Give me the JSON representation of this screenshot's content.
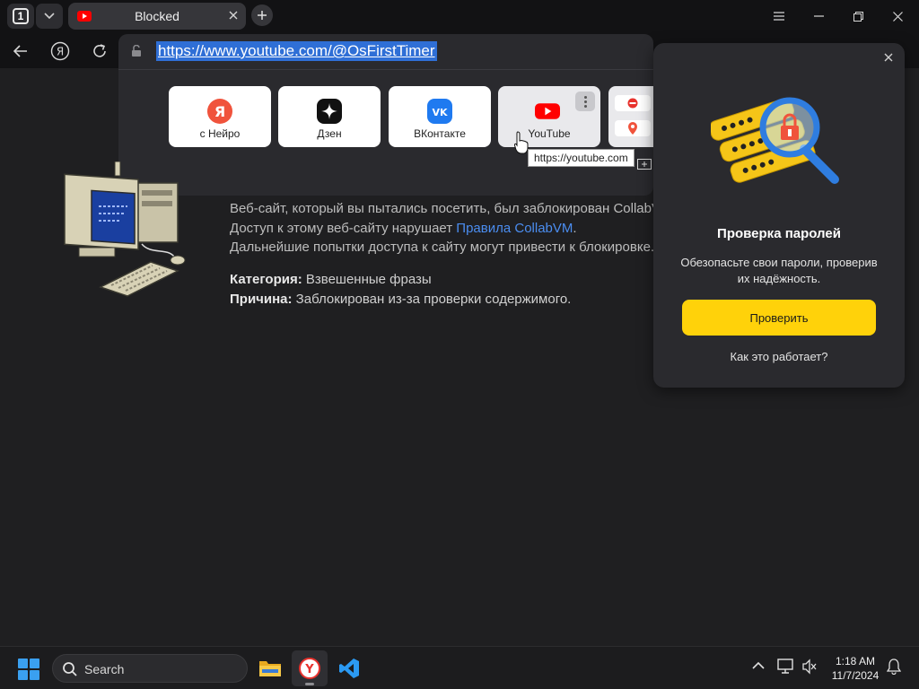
{
  "browser": {
    "tab_count": "1",
    "tab_title": "Blocked",
    "url": "https://www.youtube.com/@OsFirstTimer"
  },
  "speed_dial": {
    "tiles": [
      {
        "label": "с Нейро",
        "icon": "yandex-icon"
      },
      {
        "label": "Дзен",
        "icon": "dzen-icon"
      },
      {
        "label": "ВКонтакте",
        "icon": "vk-icon"
      },
      {
        "label": "YouTube",
        "icon": "youtube-icon"
      }
    ],
    "tooltip": "https://youtube.com"
  },
  "blocked_page": {
    "line1": "Веб-сайт, который вы пытались посетить, был заблокирован CollabVM.",
    "line2_prefix": "Доступ к этому веб-сайту нарушает ",
    "line2_link": "Правила CollabVM",
    "line2_suffix": ".",
    "line3": "Дальнейшие попытки доступа к сайту могут привести к блокировке.",
    "category_label": "Категория:",
    "category_value": " Взвешенные фразы",
    "reason_label": "Причина:",
    "reason_value": " Заблокирован из-за проверки содержимого."
  },
  "password_popup": {
    "title": "Проверка паролей",
    "description": "Обезопасьте свои пароли, проверив их надёжность.",
    "button": "Проверить",
    "link": "Как это работает?"
  },
  "taskbar": {
    "search_label": "Search",
    "time": "1:18 AM",
    "date": "11/7/2024"
  },
  "colors": {
    "accent_yellow": "#ffd20a",
    "url_highlight": "#2f6fd6",
    "link_blue": "#4b8df0",
    "youtube_red": "#ff0000"
  }
}
